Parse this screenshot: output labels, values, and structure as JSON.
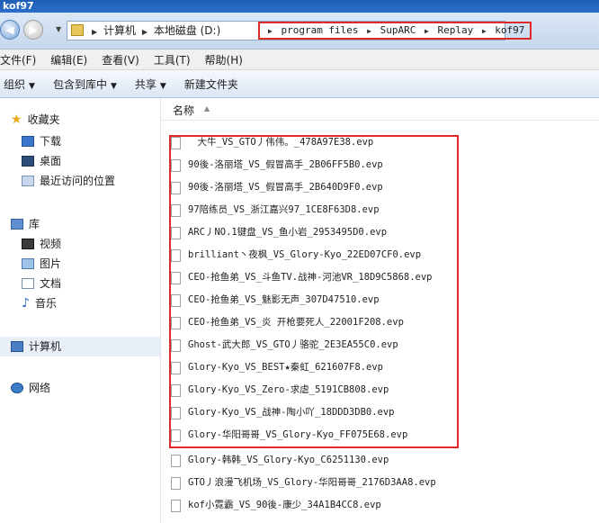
{
  "window": {
    "title": "kof97"
  },
  "address": {
    "native_crumbs": [
      "计算机",
      "本地磁盘 (D:)"
    ],
    "path_crumbs": [
      "program files",
      "SupARC",
      "Replay",
      "kof97"
    ]
  },
  "menubar": [
    "文件(F)",
    "编辑(E)",
    "查看(V)",
    "工具(T)",
    "帮助(H)"
  ],
  "cmdbar": {
    "organize": "组织",
    "include": "包含到库中",
    "share": "共享",
    "new_folder": "新建文件夹"
  },
  "nav": {
    "favorites": "收藏夹",
    "downloads": "下载",
    "desktop": "桌面",
    "recent": "最近访问的位置",
    "library": "库",
    "videos": "视频",
    "pictures": "图片",
    "documents": "文档",
    "music": "音乐",
    "computer": "计算机",
    "network": "网络"
  },
  "filelist": {
    "column_name": "名称",
    "files": [
      "　大牛_VS_GTO丿伟伟。_478A97E38.evp",
      "90後-洛丽塔_VS_假冒高手_2B06FF5B0.evp",
      "90後-洛丽塔_VS_假冒高手_2B640D9F0.evp",
      "97陪练员_VS_浙江嘉兴97_1CE8F63D8.evp",
      "ARC丿NO.1键盘_VS_鱼小岩_2953495D0.evp",
      "brilliant丶夜枫_VS_Glory-Kyo_22ED07CF0.evp",
      "CEO-抢鱼弟_VS_斗鱼TV.战神-河池VR_18D9C5868.evp",
      "CEO-抢鱼弟_VS_魅影无声_307D47510.evp",
      "CEO-抢鱼弟_VS_炎 开枪要死人_22001F208.evp",
      "Ghost-武大郎_VS_GTO丿骆驼_2E3EA55C0.evp",
      "Glory-Kyo_VS_BEST★秦虹_621607F8.evp",
      "Glory-Kyo_VS_Zero-求虐_5191CB808.evp",
      "Glory-Kyo_VS_战神-陶小吖_18DDD3DB0.evp",
      "Glory-华阳哥哥_VS_Glory-Kyo_FF075E68.evp",
      "Glory-韩韩_VS_Glory-Kyo_C6251130.evp",
      "GTO丿浪漫飞机场_VS_Glory-华阳哥哥_2176D3AA8.evp",
      "kof小霓霸_VS_90後-康少_34A1B4CC8.evp"
    ]
  }
}
